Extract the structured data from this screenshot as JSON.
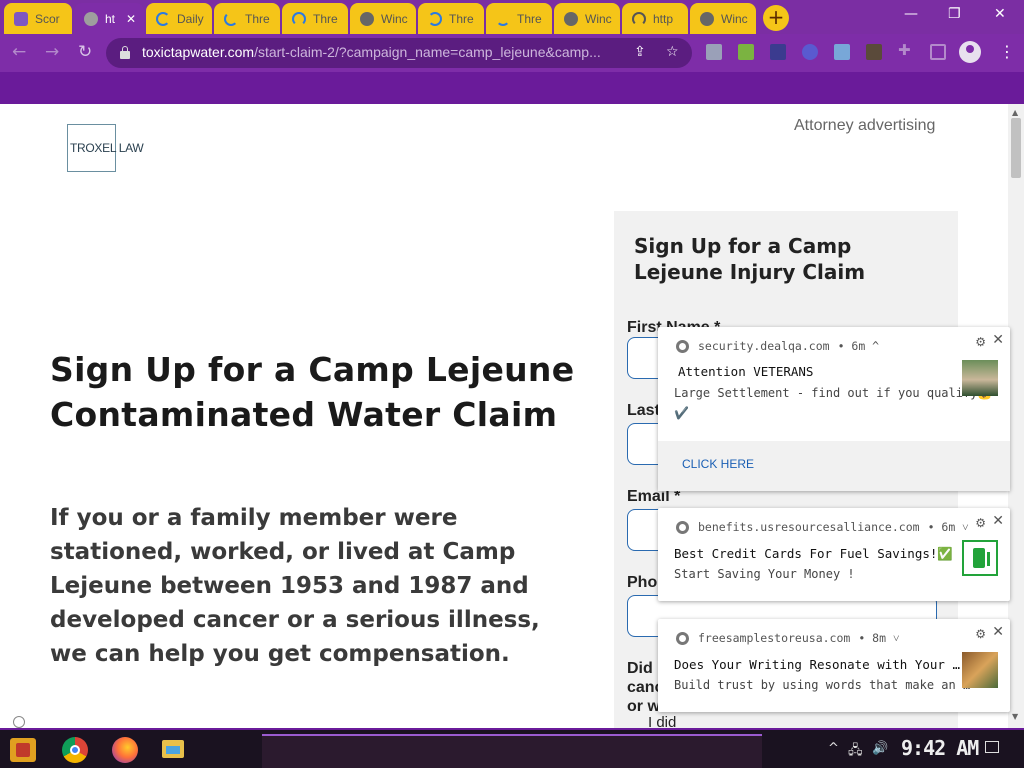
{
  "browser": {
    "tabs": [
      {
        "label": "Scor",
        "icon": "s-favicon",
        "color": "#7e57c2"
      },
      {
        "label": "ht",
        "icon": "globe-icon",
        "color": "#9e9e9e",
        "active": true
      },
      {
        "label": "Daily",
        "icon": "loading-icon",
        "color": "#2a7ae2"
      },
      {
        "label": "Thre",
        "icon": "loading-icon",
        "color": "#2a7ae2"
      },
      {
        "label": "Thre",
        "icon": "loading-icon",
        "color": "#2a7ae2"
      },
      {
        "label": "Winc",
        "icon": "globe-icon",
        "color": "#666666"
      },
      {
        "label": "Thre",
        "icon": "loading-icon",
        "color": "#2a7ae2"
      },
      {
        "label": "Thre",
        "icon": "loading-icon",
        "color": "#2a7ae2"
      },
      {
        "label": "Winc",
        "icon": "globe-icon",
        "color": "#666666"
      },
      {
        "label": "http",
        "icon": "loading-icon",
        "color": "#555555"
      },
      {
        "label": "Winc",
        "icon": "globe-icon",
        "color": "#666666"
      }
    ],
    "url_host": "toxictapwater.com",
    "url_path": "/start-claim-2/?campaign_name=camp_lejeune&camp..."
  },
  "page": {
    "logo_text": "TROXEL LAW",
    "advertising_label": "Attorney advertising",
    "headline": "Sign Up for a Camp Lejeune Contaminated Water Claim",
    "body": "If you or a family member were stationed, worked, or lived at Camp Lejeune between 1953 and 1987 and developed cancer or a serious illness, we can help you get compensation.",
    "form": {
      "title": "Sign Up for a Camp Lejeune Injury Claim",
      "first_name_label": "First Name *",
      "last_name_label": "Last",
      "email_label": "Email *",
      "phone_label": "Pho",
      "question_line1": "Did",
      "question_line2": "canc",
      "question_line3": "or w",
      "radio_label": "I did"
    }
  },
  "notifications": [
    {
      "source": "security.dealqa.com",
      "time": "• 6m ^",
      "title": "Attention VETERANS",
      "message": "Large Settlement - find out if you qualify💰",
      "message2": "✔️",
      "action": "CLICK HERE"
    },
    {
      "source": "benefits.usresourcesalliance.com",
      "time": "• 6m ˅",
      "title": "Best Credit Cards For Fuel Savings!✅",
      "message": "Start Saving Your Money !"
    },
    {
      "source": "freesamplestoreusa.com",
      "time": "• 8m ˅",
      "title": "Does Your Writing Resonate with Your …",
      "message": "Build trust by using words that make an …"
    }
  ],
  "taskbar": {
    "clock": "9:42 AM"
  },
  "colors": {
    "chrome_purple": "#7e2da8",
    "tab_yellow": "#f5c518",
    "input_border": "#2a6ab0",
    "link_blue": "#1a5fb4"
  }
}
